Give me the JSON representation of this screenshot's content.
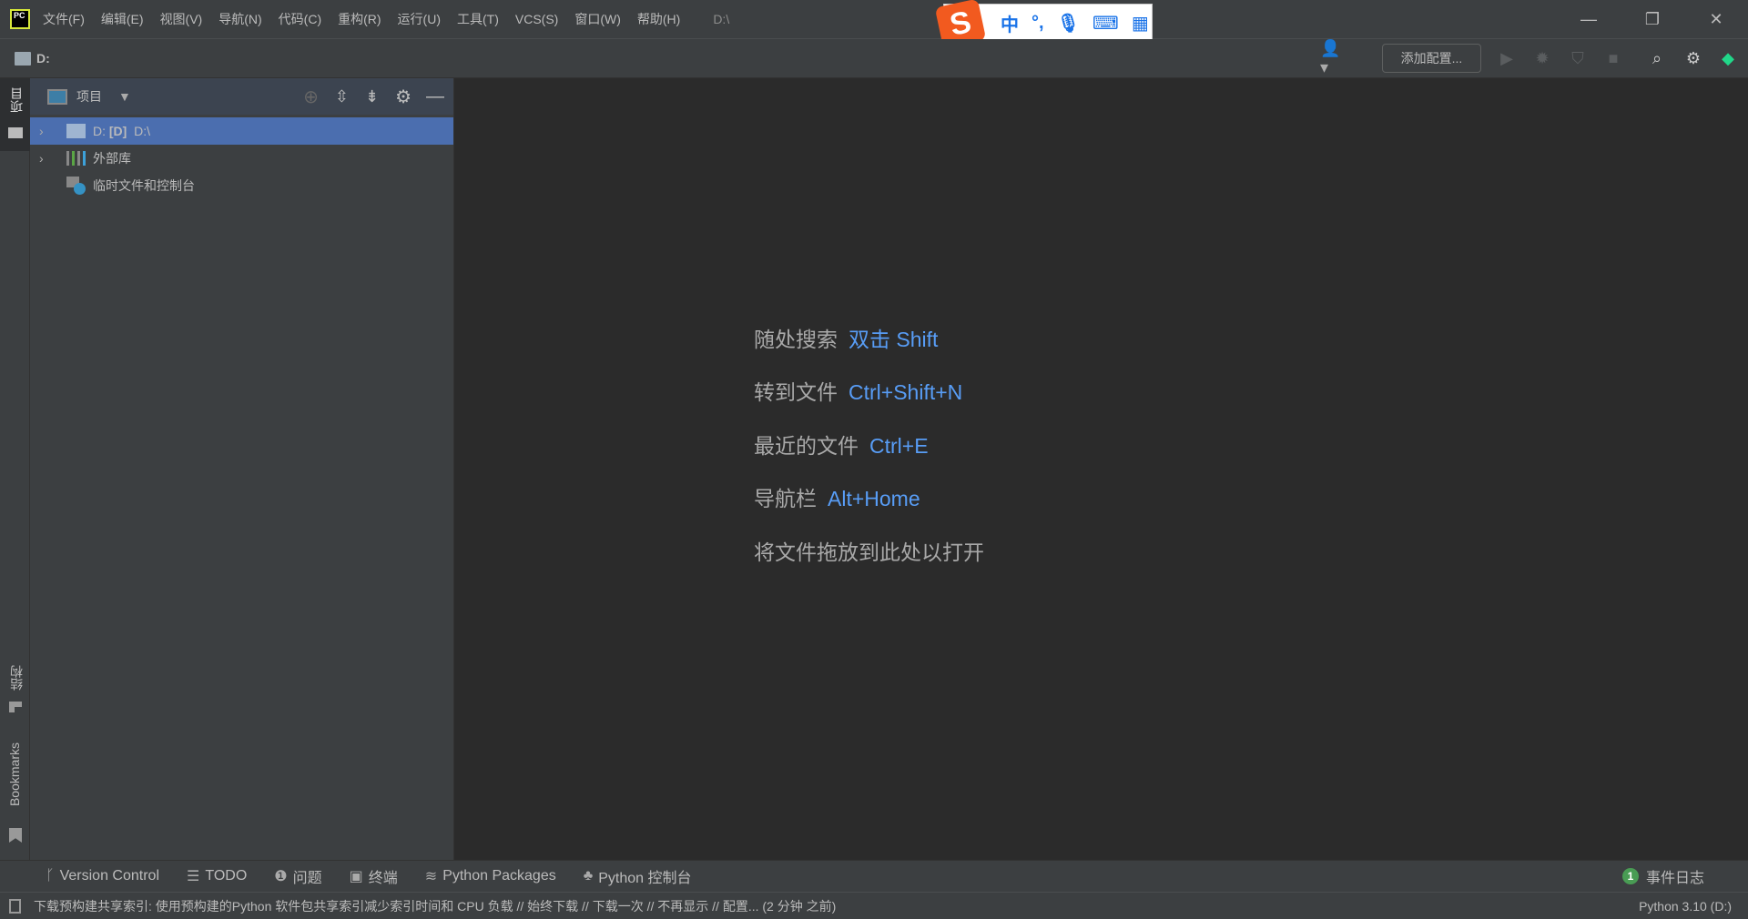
{
  "titlebar": {
    "logo_text": "PC",
    "menus": [
      "文件(F)",
      "编辑(E)",
      "视图(V)",
      "导航(N)",
      "代码(C)",
      "重构(R)",
      "运行(U)",
      "工具(T)",
      "VCS(S)",
      "窗口(W)",
      "帮助(H)"
    ],
    "path": "D:\\"
  },
  "ime": {
    "logo": "S",
    "mode": "中",
    "punct": "°,",
    "mic": "🎙",
    "keyboard": "⌨",
    "apps": "▦"
  },
  "navbar": {
    "breadcrumb": "D:",
    "add_config": "添加配置...",
    "accent": "#4b6eaf"
  },
  "left_stripe": {
    "project": "项目",
    "structure": "结构",
    "bookmarks": "Bookmarks"
  },
  "project_panel": {
    "title": "项目",
    "tree": [
      {
        "name": "D:",
        "bold": "[D]",
        "path": "D:\\",
        "selected": true
      },
      {
        "name": "外部库"
      },
      {
        "name": "临时文件和控制台"
      }
    ]
  },
  "editor_hints": [
    {
      "label": "随处搜索",
      "key": "双击 Shift"
    },
    {
      "label": "转到文件",
      "key": "Ctrl+Shift+N"
    },
    {
      "label": "最近的文件",
      "key": "Ctrl+E"
    },
    {
      "label": "导航栏",
      "key": "Alt+Home"
    },
    {
      "label": "将文件拖放到此处以打开",
      "key": ""
    }
  ],
  "tool_windows": [
    {
      "label": "Version Control",
      "icon": "branch-icon"
    },
    {
      "label": "TODO",
      "icon": "list-icon"
    },
    {
      "label": "问题",
      "icon": "problem-icon"
    },
    {
      "label": "终端",
      "icon": "terminal-icon"
    },
    {
      "label": "Python Packages",
      "icon": "layers-icon"
    },
    {
      "label": "Python 控制台",
      "icon": "python-icon"
    }
  ],
  "event_log": {
    "count": "1",
    "label": "事件日志"
  },
  "status": {
    "message": "下载预构建共享索引: 使用预构建的Python 软件包共享索引减少索引时间和 CPU 负载 // 始终下载 // 下载一次 // 不再显示 // 配置... (2 分钟 之前)",
    "interpreter": "Python 3.10 (D:)"
  }
}
